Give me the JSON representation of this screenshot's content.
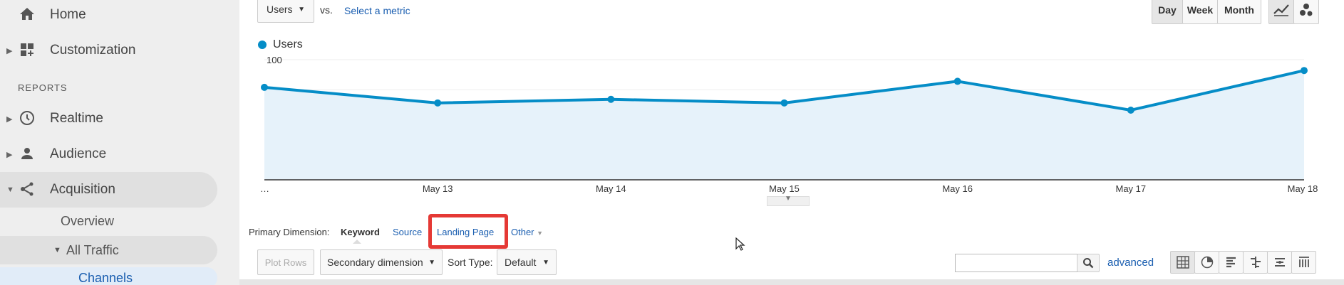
{
  "sidebar": {
    "home": "Home",
    "customization": "Customization",
    "reports_label": "REPORTS",
    "realtime": "Realtime",
    "audience": "Audience",
    "acquisition": "Acquisition",
    "overview": "Overview",
    "all_traffic": "All Traffic",
    "channels": "Channels"
  },
  "toolbar": {
    "metric_select": "Users",
    "vs_label": "vs.",
    "select_metric": "Select a metric",
    "day": "Day",
    "week": "Week",
    "month": "Month"
  },
  "chart_data": {
    "type": "area",
    "legend": "Users",
    "color": "#058dc7",
    "x": [
      "…",
      "May 13",
      "May 14",
      "May 15",
      "May 16",
      "May 17",
      "May 18"
    ],
    "values": [
      77,
      64,
      67,
      64,
      82,
      58,
      91
    ],
    "ylim": [
      0,
      100
    ],
    "yticks": [
      50,
      100
    ]
  },
  "dimension": {
    "label": "Primary Dimension:",
    "keyword": "Keyword",
    "source": "Source",
    "landing_page": "Landing Page",
    "other": "Other"
  },
  "table_controls": {
    "plot_rows": "Plot Rows",
    "secondary_dimension": "Secondary dimension",
    "sort_type_label": "Sort Type:",
    "sort_type_value": "Default",
    "advanced": "advanced"
  },
  "colors": {
    "accent": "#058dc7",
    "highlight": "#e53935",
    "link": "#1a5eb0"
  }
}
